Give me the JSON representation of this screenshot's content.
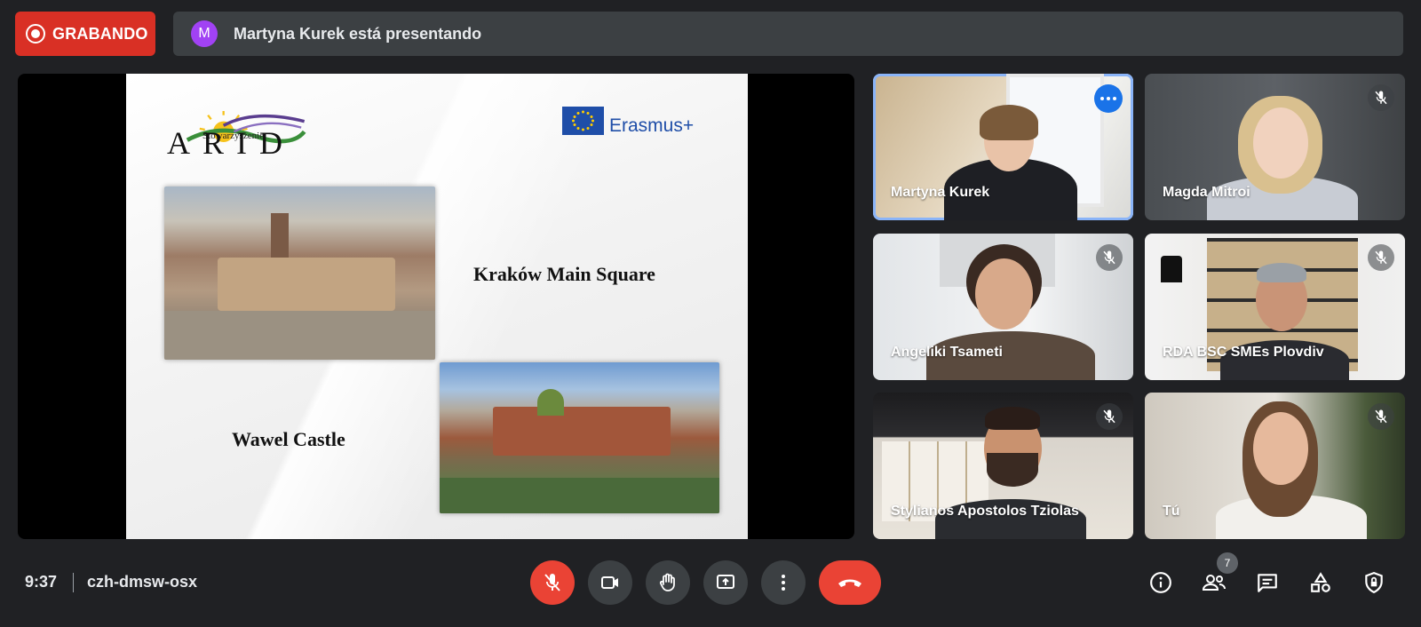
{
  "recording": {
    "label": "GRABANDO"
  },
  "presenting": {
    "avatar_letter": "M",
    "text": "Martyna Kurek está presentando"
  },
  "slide": {
    "logo_small": "Stowarzyszenie",
    "logo_big": "ARID",
    "erasmus": "Erasmus+",
    "title_krakow": "Kraków Main Square",
    "title_wawel": "Wawel Castle"
  },
  "participants": [
    {
      "name": "Martyna Kurek",
      "active": true
    },
    {
      "name": "Magda Mitroi",
      "muted": true
    },
    {
      "name": "Angeliki Tsameti",
      "muted": true
    },
    {
      "name": "RDA BSC SMEs Plovdiv",
      "muted": true
    },
    {
      "name": "Stylianos Apostolos Tziolas",
      "muted": true
    },
    {
      "name": "Tú",
      "muted": true
    }
  ],
  "footer": {
    "time": "9:37",
    "code": "czh-dmsw-osx",
    "participant_count": "7"
  },
  "colors": {
    "recording": "#d93025",
    "end_call": "#ea4335",
    "active_border": "#8ab4f8",
    "more_badge": "#1a73e8"
  }
}
